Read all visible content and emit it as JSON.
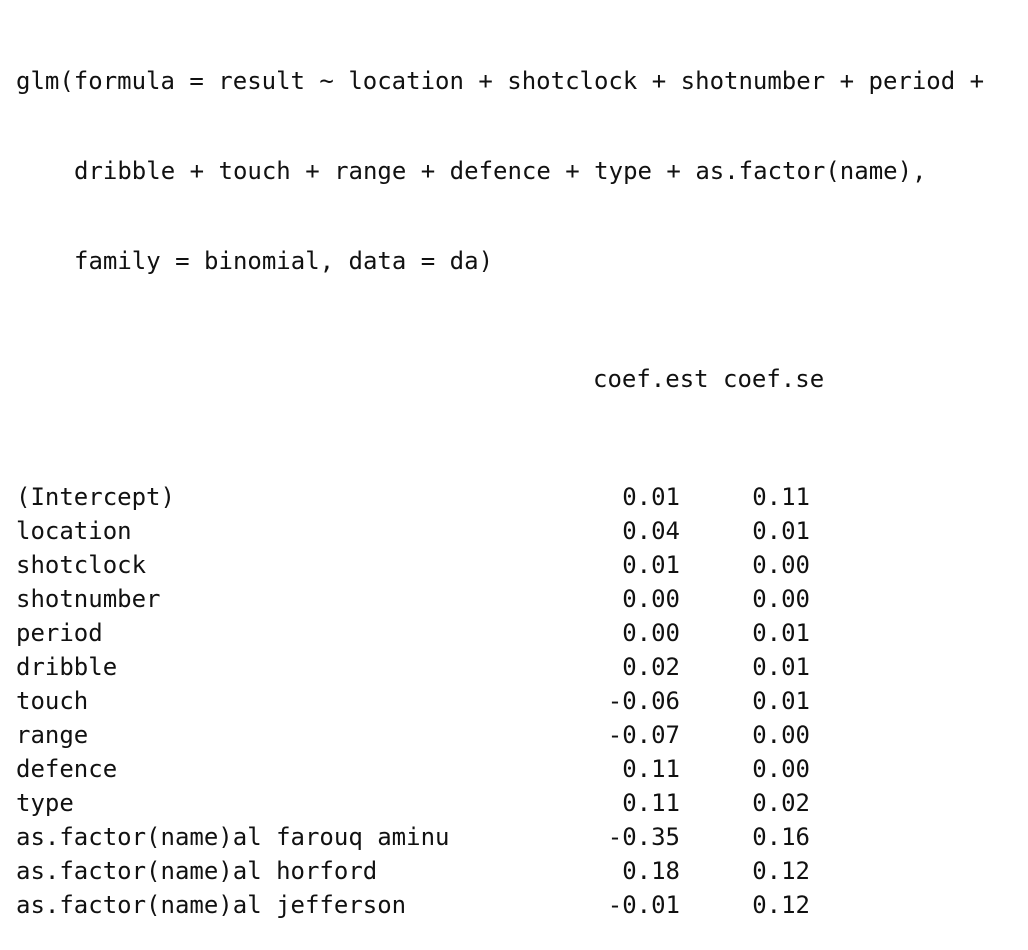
{
  "call": {
    "line1": "glm(formula = result ~ location + shotclock + shotnumber + period +",
    "line2": "dribble + touch + range + defence + type + as.factor(name),",
    "line3": "family = binomial, data = da)"
  },
  "table": {
    "columns": [
      "coef.est",
      "coef.se"
    ],
    "rows": [
      {
        "term": "(Intercept)",
        "est": "0.01",
        "se": "0.11"
      },
      {
        "term": "location",
        "est": "0.04",
        "se": "0.01"
      },
      {
        "term": "shotclock",
        "est": "0.01",
        "se": "0.00"
      },
      {
        "term": "shotnumber",
        "est": "0.00",
        "se": "0.00"
      },
      {
        "term": "period",
        "est": "0.00",
        "se": "0.01"
      },
      {
        "term": "dribble",
        "est": "0.02",
        "se": "0.01"
      },
      {
        "term": "touch",
        "est": "-0.06",
        "se": "0.01"
      },
      {
        "term": "range",
        "est": "-0.07",
        "se": "0.00"
      },
      {
        "term": "defence",
        "est": "0.11",
        "se": "0.00"
      },
      {
        "term": "type",
        "est": "0.11",
        "se": "0.02"
      },
      {
        "term": "as.factor(name)al farouq aminu",
        "est": "-0.35",
        "se": "0.16"
      },
      {
        "term": "as.factor(name)al horford",
        "est": "0.18",
        "se": "0.12"
      },
      {
        "term": "as.factor(name)al jefferson",
        "est": "-0.01",
        "se": "0.12"
      }
    ]
  }
}
